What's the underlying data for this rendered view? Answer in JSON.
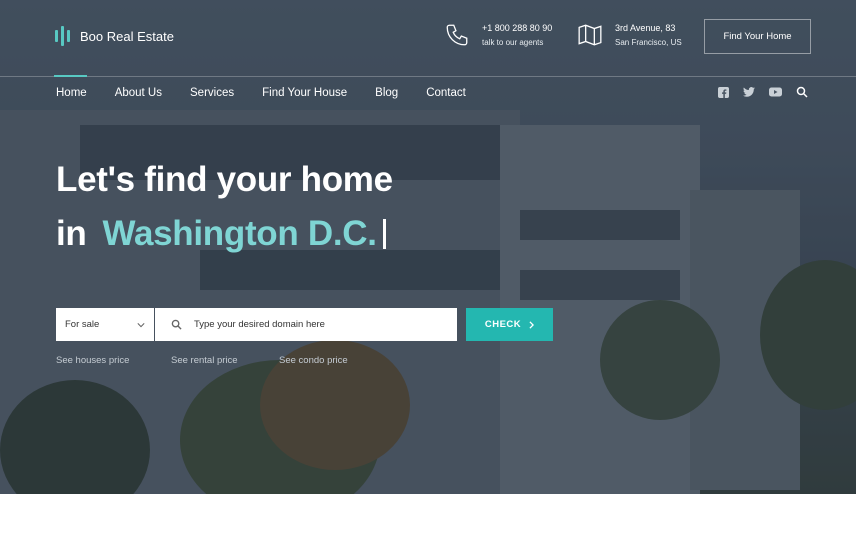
{
  "brand": {
    "name": "Boo Real Estate",
    "icon": "logo-bars-icon",
    "accent": "#58c9c3"
  },
  "header": {
    "phone": {
      "icon": "phone-icon",
      "line1": "+1 800 288 80 90",
      "line2": "talk to our agents"
    },
    "address": {
      "icon": "map-icon",
      "line1": "3rd Avenue, 83",
      "line2": "San Francisco, US"
    },
    "cta_label": "Find Your Home"
  },
  "nav": {
    "items": [
      {
        "label": "Home",
        "active": true
      },
      {
        "label": "About Us"
      },
      {
        "label": "Services"
      },
      {
        "label": "Find Your House"
      },
      {
        "label": "Blog"
      },
      {
        "label": "Contact"
      }
    ]
  },
  "social": [
    "facebook-icon",
    "twitter-icon",
    "youtube-icon",
    "search-icon"
  ],
  "hero": {
    "line1": "Let's find your home",
    "line2_prefix": "in",
    "line2_city": "Washington D.C.",
    "city_color": "#7fd5d4"
  },
  "search": {
    "type_select": "For sale",
    "placeholder": "Type your desired domain here",
    "button_label": "CHECK",
    "button_color": "#24b7b0"
  },
  "quick_links": [
    "See houses price",
    "See rental price",
    "See condo price"
  ]
}
